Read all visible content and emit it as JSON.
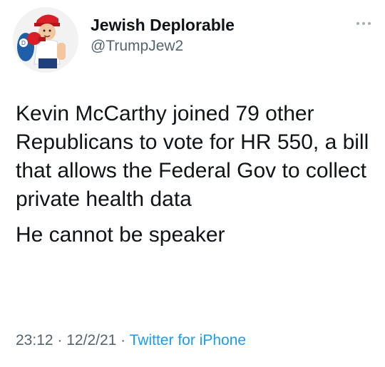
{
  "user": {
    "display_name": "Jewish Deplorable",
    "handle": "@TrumpJew2",
    "avatar_icon": "boxing-cartoon-avatar-icon"
  },
  "more_icon": "more-options-icon",
  "tweet": {
    "text": "Kevin McCarthy joined 79 other Republicans to vote for HR 550, a bill that allows the Federal Gov to collect private health data",
    "text2": "He cannot be speaker",
    "time": "23:12",
    "separator": "·",
    "date": "12/2/21",
    "source": "Twitter for iPhone"
  },
  "colors": {
    "text": "#0f1419",
    "secondary": "#536471",
    "link": "#1d9bf0"
  }
}
